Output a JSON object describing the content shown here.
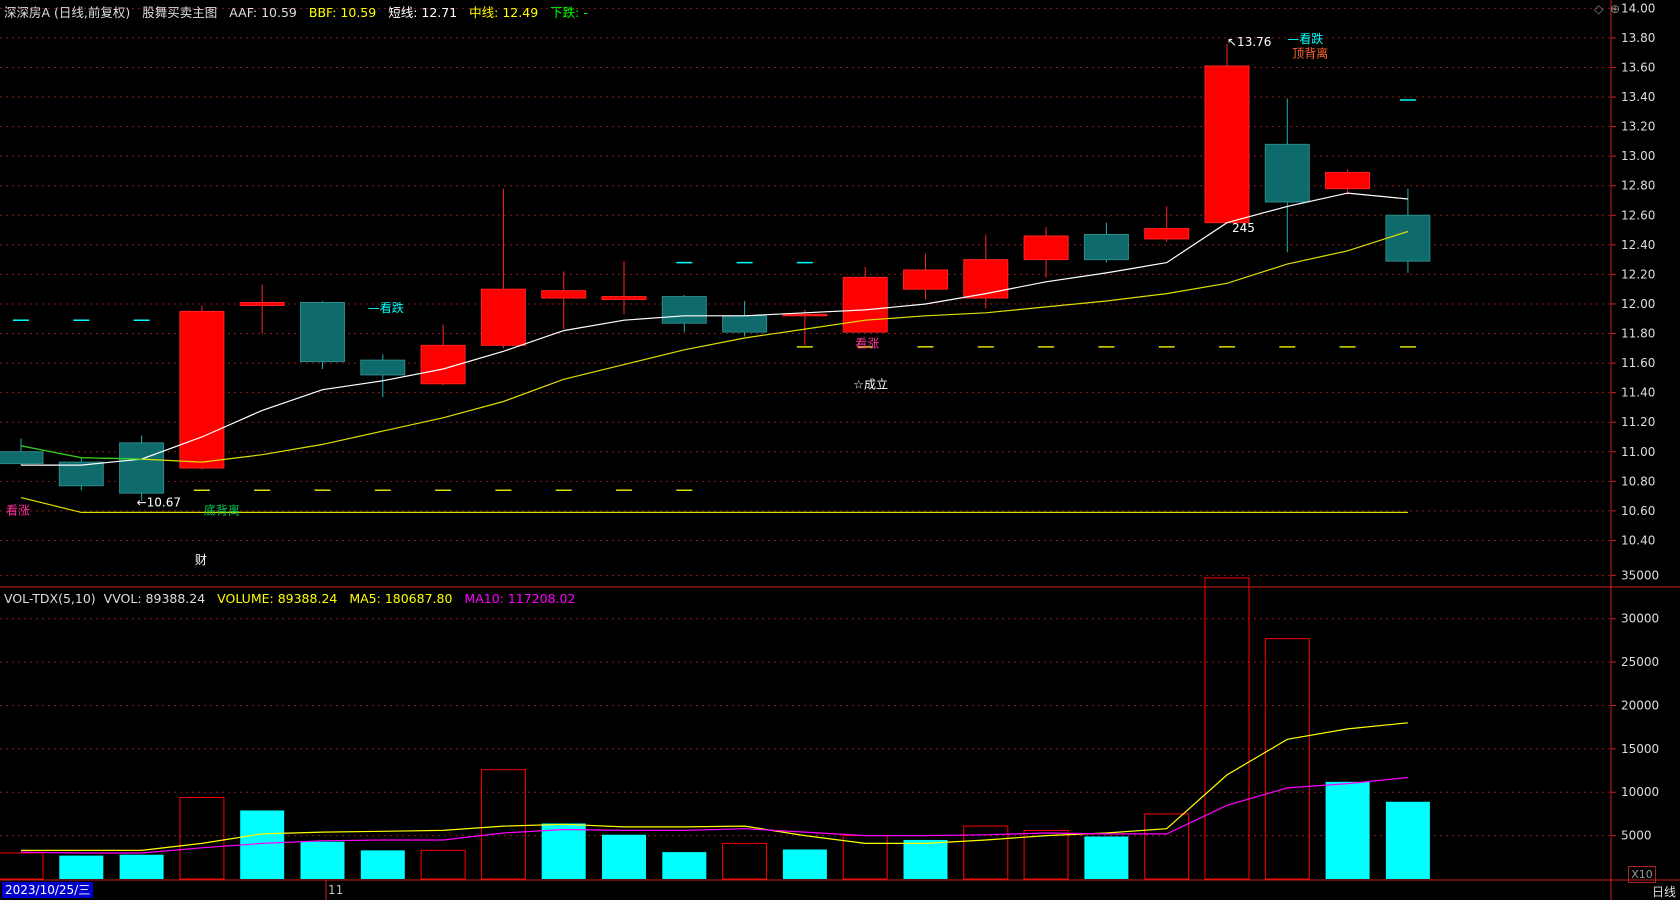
{
  "header": {
    "stock_name": "深深房A (日线,前复权)",
    "indicator_name": "股舞买卖主图",
    "aaf": "AAF: 10.59",
    "bbf": "BBF: 10.59",
    "short_line": "短线: 12.71",
    "mid_line": "中线: 12.49",
    "trend": "下跌: -"
  },
  "vol_header": {
    "name": "VOL-TDX(5,10)",
    "vvol": "VVOL: 89388.24",
    "volume": "VOLUME: 89388.24",
    "ma5": "MA5: 180687.80",
    "ma10": "MA10: 117208.02"
  },
  "footer": {
    "date": "2023/10/25/三",
    "month": "11",
    "period": "日线",
    "unit": "X10"
  },
  "colors": {
    "up": "#ff0000",
    "down": "#0f6b6b",
    "down_vol": "#00ffff",
    "short": "#ffffff",
    "mid": "#dede00",
    "ma5": "#ffff00",
    "ma10": "#ff00ff",
    "grid": "#8b1a1a",
    "axis": "#cc2222"
  },
  "chart_data": [
    {
      "type": "candlestick",
      "ylim": [
        10.2,
        14.1
      ],
      "yticks": [
        "10.40",
        "10.60",
        "10.80",
        "11.00",
        "11.20",
        "11.40",
        "11.60",
        "11.80",
        "12.00",
        "12.20",
        "12.40",
        "12.60",
        "12.80",
        "13.00",
        "13.20",
        "13.40",
        "13.60",
        "13.80",
        "14.00"
      ],
      "candles": [
        {
          "open": 11.0,
          "close": 10.92,
          "high": 11.09,
          "low": 10.91
        },
        {
          "open": 10.93,
          "close": 10.77,
          "high": 10.96,
          "low": 10.74
        },
        {
          "open": 11.06,
          "close": 10.72,
          "high": 11.11,
          "low": 10.67
        },
        {
          "open": 10.89,
          "close": 11.95,
          "high": 11.99,
          "low": 10.88
        },
        {
          "open": 11.99,
          "close": 12.01,
          "high": 12.13,
          "low": 11.8
        },
        {
          "open": 12.01,
          "close": 11.61,
          "high": 12.02,
          "low": 11.56
        },
        {
          "open": 11.62,
          "close": 11.52,
          "high": 11.66,
          "low": 11.37
        },
        {
          "open": 11.46,
          "close": 11.72,
          "high": 11.86,
          "low": 11.45
        },
        {
          "open": 11.72,
          "close": 12.1,
          "high": 12.78,
          "low": 11.7
        },
        {
          "open": 12.04,
          "close": 12.09,
          "high": 12.22,
          "low": 11.83
        },
        {
          "open": 12.03,
          "close": 12.05,
          "high": 12.29,
          "low": 11.93
        },
        {
          "open": 12.05,
          "close": 11.87,
          "high": 12.06,
          "low": 11.81
        },
        {
          "open": 11.92,
          "close": 11.81,
          "high": 12.02,
          "low": 11.78
        },
        {
          "open": 11.93,
          "close": 11.93,
          "high": 11.96,
          "low": 11.72
        },
        {
          "open": 11.81,
          "close": 12.18,
          "high": 12.25,
          "low": 11.81
        },
        {
          "open": 12.1,
          "close": 12.23,
          "high": 12.34,
          "low": 12.03
        },
        {
          "open": 12.04,
          "close": 12.3,
          "high": 12.47,
          "low": 11.97
        },
        {
          "open": 12.3,
          "close": 12.46,
          "high": 12.52,
          "low": 12.18
        },
        {
          "open": 12.47,
          "close": 12.3,
          "high": 12.55,
          "low": 12.28
        },
        {
          "open": 12.44,
          "close": 12.51,
          "high": 12.66,
          "low": 12.42
        },
        {
          "open": 12.55,
          "close": 13.61,
          "high": 13.76,
          "low": 12.55
        },
        {
          "open": 13.08,
          "close": 12.69,
          "high": 13.39,
          "low": 12.35
        },
        {
          "open": 12.78,
          "close": 12.89,
          "high": 12.91,
          "low": 12.74
        },
        {
          "open": 12.6,
          "close": 12.29,
          "high": 12.78,
          "low": 12.21
        }
      ],
      "short_line": [
        10.91,
        10.91,
        10.95,
        11.1,
        11.28,
        11.42,
        11.48,
        11.56,
        11.68,
        11.82,
        11.89,
        11.92,
        11.92,
        11.94,
        11.96,
        12.0,
        12.07,
        12.15,
        12.21,
        12.28,
        12.55,
        12.66,
        12.75,
        12.71
      ],
      "mid_line": [
        11.04,
        10.96,
        10.95,
        10.93,
        10.98,
        11.05,
        11.14,
        11.23,
        11.34,
        11.49,
        11.59,
        11.69,
        11.77,
        11.83,
        11.89,
        11.92,
        11.94,
        11.98,
        12.02,
        12.07,
        12.14,
        12.27,
        12.36,
        12.49
      ],
      "support_line": [
        10.69,
        10.59,
        10.59,
        10.59,
        10.59,
        10.59,
        10.59,
        10.59,
        10.59,
        10.59,
        10.59,
        10.59,
        10.59,
        10.59,
        10.59,
        10.59,
        10.59,
        10.59,
        10.59,
        10.59,
        10.59,
        10.59,
        10.59,
        10.59
      ],
      "dash_levels": [
        {
          "value": 11.89,
          "color": "#00ffff",
          "from": 0,
          "to": 2
        },
        {
          "value": 10.74,
          "color": "#dede00",
          "from": 3,
          "to": 11
        },
        {
          "value": 12.28,
          "color": "#00ffff",
          "from": 11,
          "to": 13
        },
        {
          "value": 11.71,
          "color": "#dede00",
          "from": 13,
          "to": 23
        },
        {
          "value": 13.38,
          "color": "#00ffff",
          "from": 23,
          "to": 23
        }
      ],
      "annotations": [
        {
          "text": "看涨",
          "x": 0,
          "dx": -15,
          "y": 10.59,
          "dy": 2,
          "color": "#ff3399"
        },
        {
          "text": "←10.67",
          "x": 2,
          "dx": -5,
          "y": 10.67,
          "dy": 6,
          "color": "#ffffff"
        },
        {
          "text": "底背离",
          "x": 3,
          "dx": 2,
          "y": 10.59,
          "dy": 2,
          "color": "#00cc55"
        },
        {
          "text": "财",
          "x": 3,
          "dx": -7,
          "y": 10.2,
          "dy": -6,
          "color": "#ffffff"
        },
        {
          "text": "—看跌",
          "x": 6,
          "dx": -15,
          "y": 11.96,
          "dy": 2,
          "color": "#00ffff"
        },
        {
          "text": "看涨",
          "x": 14,
          "dx": -10,
          "y": 11.72,
          "dy": 2,
          "color": "#ff3399"
        },
        {
          "text": "☆成立",
          "x": 14,
          "dx": -12,
          "y": 11.44,
          "dy": 2,
          "color": "#ffffff"
        },
        {
          "text": "↖13.76",
          "x": 20,
          "dx": 0,
          "y": 13.76,
          "dy": 2,
          "color": "#ffffff"
        },
        {
          "text": "—看跌",
          "x": 21,
          "dx": 0,
          "y": 13.78,
          "dy": 2,
          "color": "#00ffff"
        },
        {
          "text": "顶背离",
          "x": 21,
          "dx": 5,
          "y": 13.68,
          "dy": 2,
          "color": "#ff6633"
        },
        {
          "text": "245",
          "x": 20,
          "dx": 5,
          "y": 12.5,
          "dy": 2,
          "color": "#ffffff"
        }
      ]
    },
    {
      "type": "bar",
      "ylim": [
        0,
        37000
      ],
      "yticks": [
        "5000",
        "10000",
        "15000",
        "20000",
        "25000",
        "30000",
        "35000"
      ],
      "volume": [
        3000,
        2700,
        2800,
        9400,
        7900,
        4300,
        3300,
        3300,
        12600,
        6400,
        5100,
        3100,
        4100,
        3400,
        5000,
        4500,
        6100,
        5600,
        4900,
        7500,
        34700,
        27700,
        11200,
        8900
      ],
      "up": [
        true,
        false,
        false,
        true,
        false,
        false,
        false,
        true,
        true,
        false,
        false,
        false,
        true,
        false,
        true,
        false,
        true,
        true,
        false,
        true,
        true,
        true,
        false,
        false
      ],
      "ma5": [
        3300,
        3300,
        3300,
        4100,
        5200,
        5400,
        5500,
        5600,
        6100,
        6300,
        6000,
        6000,
        6100,
        5000,
        4100,
        4100,
        4500,
        5000,
        5300,
        5800,
        12000,
        16100,
        17300,
        18000
      ],
      "ma10": [
        3100,
        3000,
        3000,
        3600,
        4100,
        4400,
        4500,
        4500,
        5300,
        5700,
        5600,
        5600,
        5800,
        5400,
        5000,
        5000,
        5100,
        5300,
        5200,
        5200,
        8500,
        10500,
        11000,
        11700
      ]
    }
  ]
}
